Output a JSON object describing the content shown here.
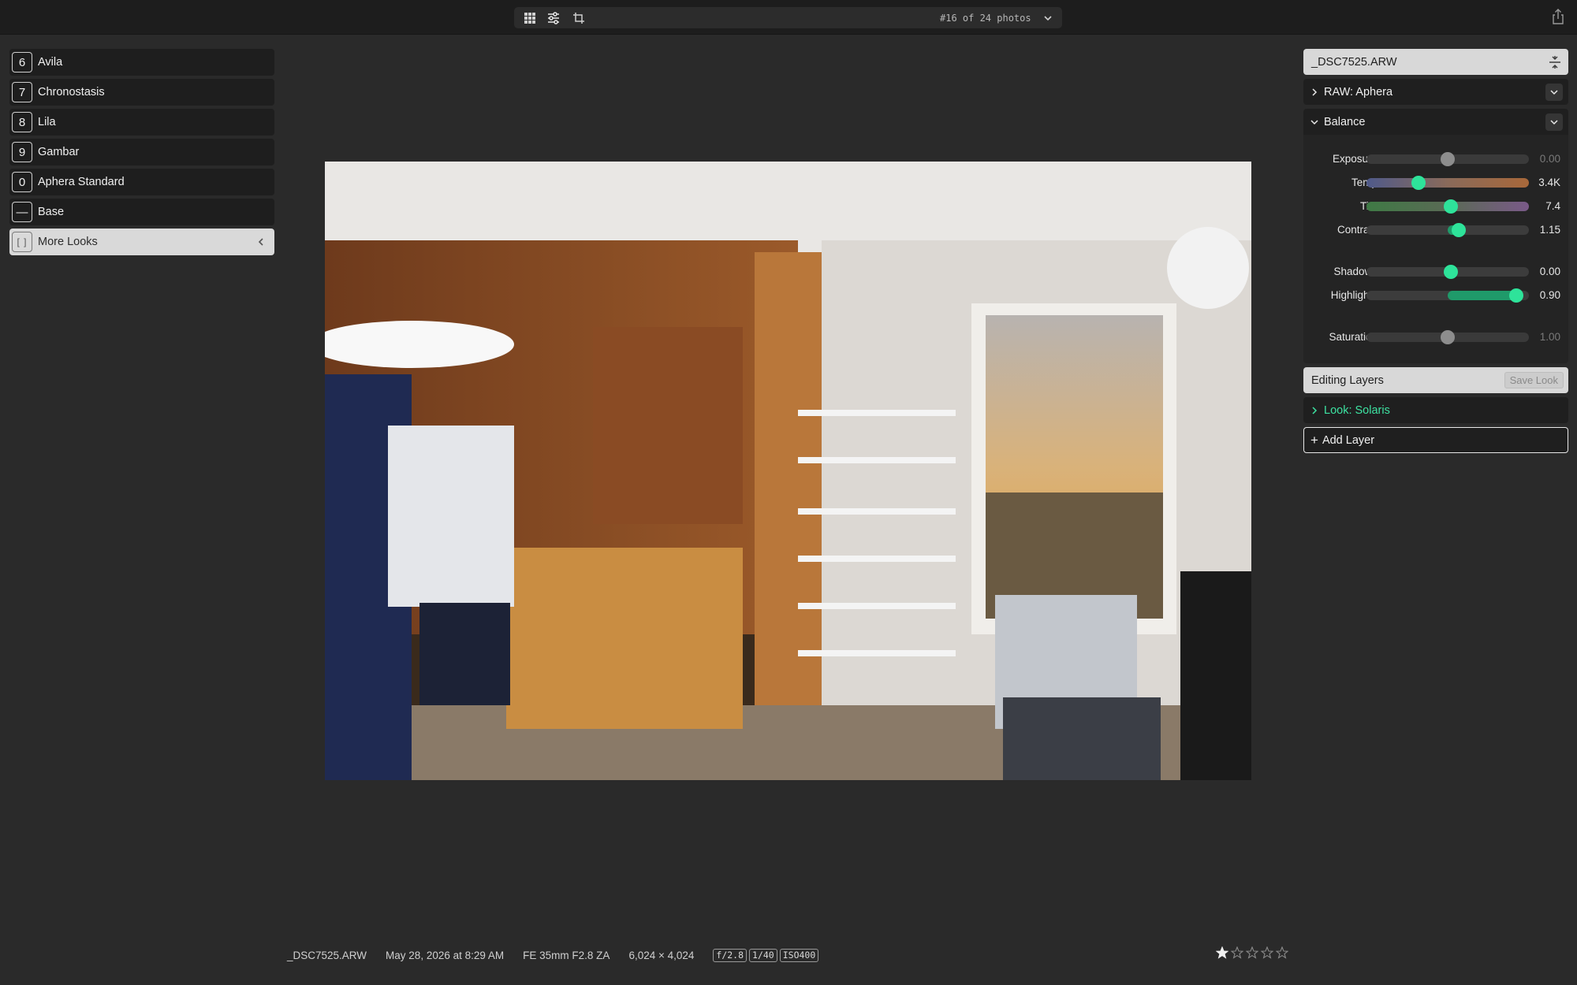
{
  "toolbar": {
    "photo_counter": "#16 of 24 photos",
    "icons": [
      "grid-icon",
      "sliders-icon",
      "crop-icon",
      "chevron-down-icon",
      "share-icon"
    ]
  },
  "looks": {
    "items": [
      {
        "key": "6",
        "name": "Avila"
      },
      {
        "key": "7",
        "name": "Chronostasis"
      },
      {
        "key": "8",
        "name": "Lila"
      },
      {
        "key": "9",
        "name": "Gambar"
      },
      {
        "key": "0",
        "name": "Aphera Standard"
      },
      {
        "key": "—",
        "name": "Base"
      }
    ],
    "more": {
      "key": "[ ]",
      "name": "More Looks"
    }
  },
  "panel": {
    "file_name": "_DSC7525.ARW",
    "raw_section": "RAW: Aphera",
    "balance_section": "Balance",
    "sliders": [
      {
        "label": "Exposure",
        "value": "0.00",
        "position": 0.5
      },
      {
        "label": "Temp",
        "value": "3.4K",
        "position": 0.32
      },
      {
        "label": "Tint",
        "value": "7.4",
        "position": 0.52
      },
      {
        "label": "Contrast",
        "value": "1.15",
        "position": 0.57
      },
      {
        "label": "Shadows",
        "value": "0.00",
        "position": 0.52
      },
      {
        "label": "Highlights",
        "value": "0.90",
        "position": 0.92
      },
      {
        "label": "Saturation",
        "value": "1.00",
        "position": 0.5
      }
    ],
    "editing_layers": "Editing Layers",
    "save_look": "Save Look",
    "layer_name": "Look: Solaris",
    "add_layer": "Add Layer"
  },
  "info": {
    "file": "_DSC7525.ARW",
    "date": "May 28, 2026 at 8:29 AM",
    "lens": "FE 35mm F2.8 ZA",
    "dimensions": "6,024 × 4,024",
    "aperture": "f/2.8",
    "shutter": "1/40",
    "iso": "ISO400"
  },
  "rating": {
    "value": 1,
    "max": 5
  },
  "colors": {
    "accent": "#3de3a2",
    "background": "#2a2a2a",
    "panel": "#1f1f1f"
  }
}
